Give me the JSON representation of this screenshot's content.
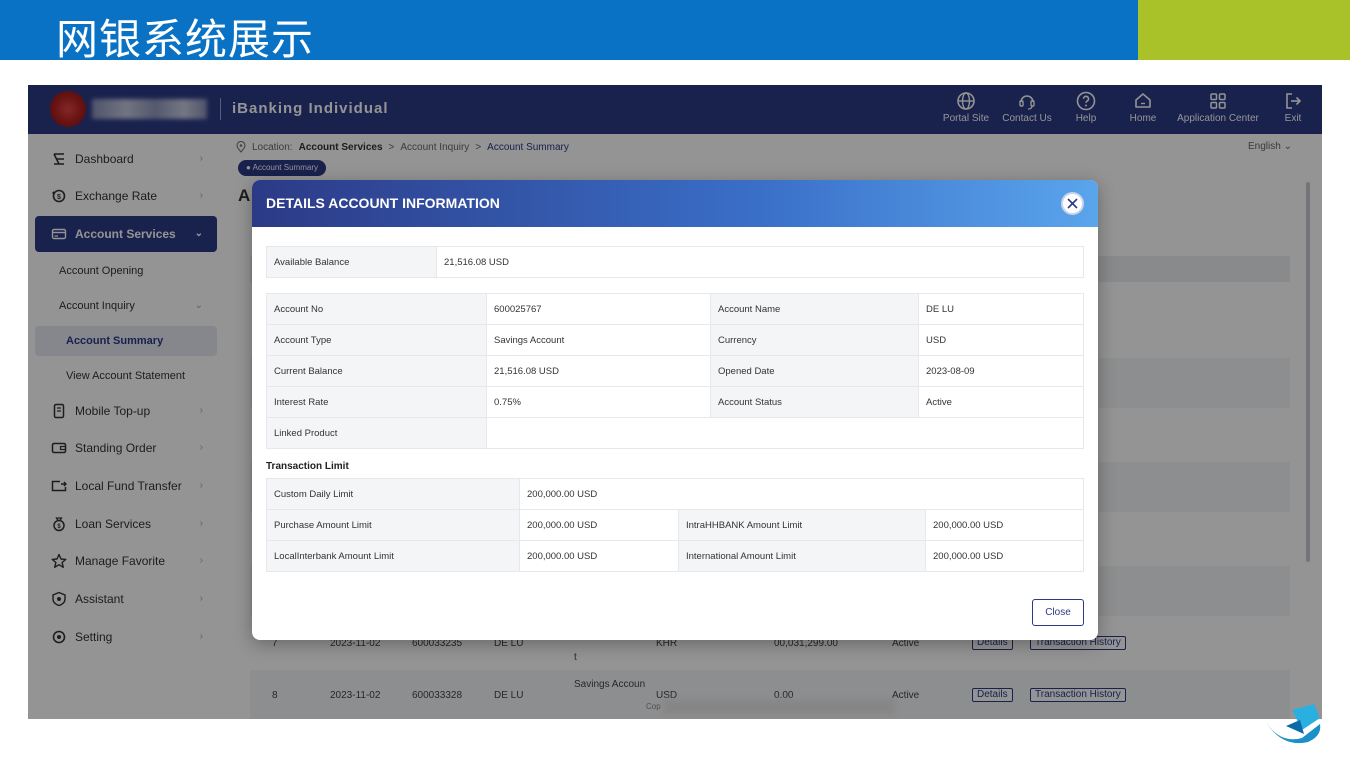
{
  "slide": {
    "title": "网银系统展示"
  },
  "app": {
    "name": "iBanking Individual"
  },
  "topnav": [
    {
      "label": "Portal Site",
      "icon": "globe-icon"
    },
    {
      "label": "Contact Us",
      "icon": "headset-icon"
    },
    {
      "label": "Help",
      "icon": "question-icon"
    },
    {
      "label": "Home",
      "icon": "home-icon"
    },
    {
      "label": "Application Center",
      "icon": "grid-icon"
    },
    {
      "label": "Exit",
      "icon": "exit-icon"
    }
  ],
  "sidebar": {
    "items": [
      {
        "label": "Dashboard",
        "icon": "dashboard-icon"
      },
      {
        "label": "Exchange Rate",
        "icon": "exchange-icon"
      },
      {
        "label": "Account Services",
        "icon": "card-icon"
      },
      {
        "label": "Mobile Top-up",
        "icon": "mobile-icon"
      },
      {
        "label": "Standing Order",
        "icon": "wallet-icon"
      },
      {
        "label": "Local Fund Transfer",
        "icon": "transfer-icon"
      },
      {
        "label": "Loan Services",
        "icon": "loan-icon"
      },
      {
        "label": "Manage Favorite",
        "icon": "star-icon"
      },
      {
        "label": "Assistant",
        "icon": "shield-icon"
      },
      {
        "label": "Setting",
        "icon": "gear-icon"
      }
    ],
    "sub": {
      "account_opening": "Account Opening",
      "account_inquiry": "Account Inquiry",
      "account_summary": "Account Summary",
      "view_statement": "View Account Statement"
    }
  },
  "breadcrumb": {
    "prefix": "Location:",
    "l1": "Account Services",
    "sep": ">",
    "l2": "Account Inquiry",
    "l3": "Account Summary"
  },
  "language": "English",
  "chip": "Account Summary",
  "page_heading": "A",
  "bg_rows": [
    {
      "no": "7",
      "date": "2023-11-02",
      "account": "600033235",
      "name": "DE LU",
      "type": "t",
      "currency": "KHR",
      "balance": "00,031,299.00",
      "status": "Active",
      "details": "Details",
      "history": "Transaction History"
    },
    {
      "no": "8",
      "date": "2023-11-02",
      "account": "600033328",
      "name": "DE LU",
      "type": "Savings Accoun",
      "currency": "USD",
      "balance": "0.00",
      "status": "Active",
      "details": "Details",
      "history": "Transaction History"
    }
  ],
  "copyright_prefix": "Cop",
  "modal": {
    "title": "DETAILS ACCOUNT INFORMATION",
    "available_balance_label": "Available Balance",
    "available_balance_value": "21,516.08 USD",
    "account": {
      "account_no_label": "Account No",
      "account_no": "600025767",
      "account_name_label": "Account Name",
      "account_name": "DE LU",
      "account_type_label": "Account Type",
      "account_type": "Savings Account",
      "currency_label": "Currency",
      "currency": "USD",
      "current_balance_label": "Current Balance",
      "current_balance": "21,516.08 USD",
      "opened_date_label": "Opened Date",
      "opened_date": "2023-08-09",
      "interest_rate_label": "Interest Rate",
      "interest_rate": "0.75%",
      "account_status_label": "Account Status",
      "account_status": "Active",
      "linked_product_label": "Linked Product",
      "linked_product": ""
    },
    "limits_heading": "Transaction Limit",
    "limits": {
      "custom_daily_label": "Custom Daily Limit",
      "custom_daily": "200,000.00 USD",
      "purchase_label": "Purchase Amount Limit",
      "purchase": "200,000.00 USD",
      "intra_label": "IntraHHBANK Amount Limit",
      "intra": "200,000.00 USD",
      "local_label": "LocalInterbank Amount Limit",
      "local": "200,000.00 USD",
      "international_label": "International Amount Limit",
      "international": "200,000.00 USD"
    },
    "close_label": "Close"
  },
  "colors": {
    "brand": "#2c3a86",
    "banner": "#0a72c4",
    "accent": "#a9c22a"
  }
}
